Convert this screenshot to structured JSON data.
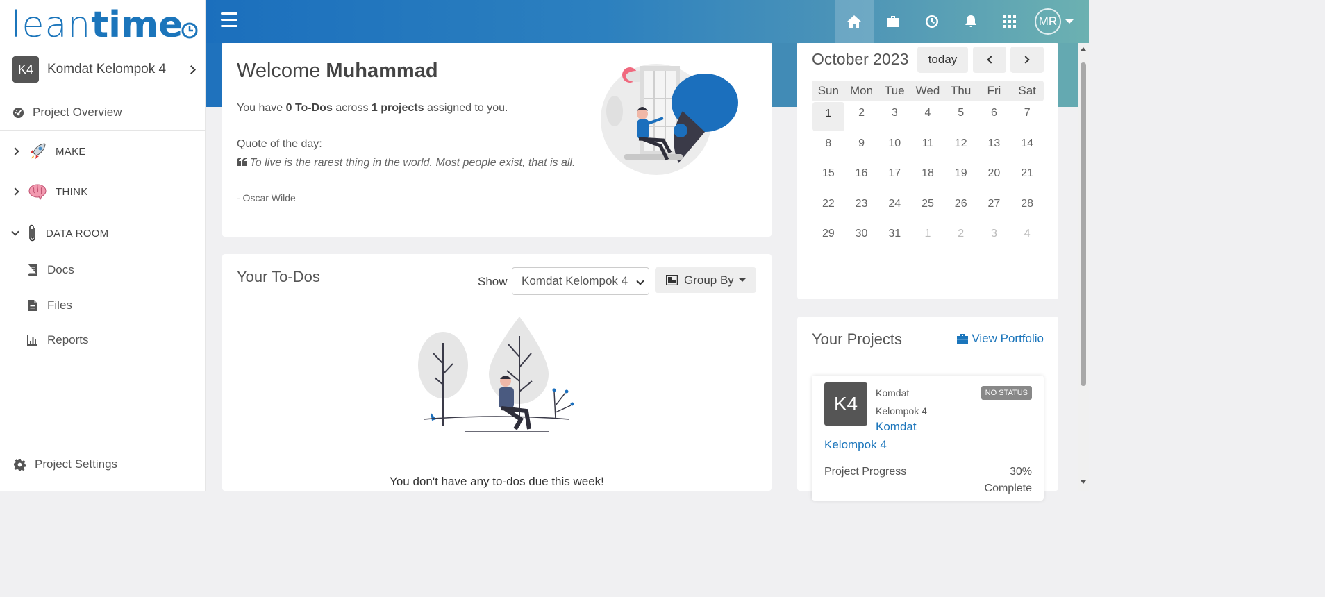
{
  "brand": {
    "logo_part1": "lean",
    "logo_part2": "time"
  },
  "sidebar": {
    "project": {
      "badge": "K4",
      "name": "Komdat Kelompok 4"
    },
    "overview_label": "Project Overview",
    "groups": [
      {
        "label": "MAKE",
        "expanded": false,
        "icon": "rocket-icon"
      },
      {
        "label": "THINK",
        "expanded": false,
        "icon": "brain-icon"
      },
      {
        "label": "DATA ROOM",
        "expanded": true,
        "icon": "paperclip-icon"
      }
    ],
    "data_room_items": [
      {
        "label": "Docs",
        "icon": "book-icon"
      },
      {
        "label": "Files",
        "icon": "file-icon"
      },
      {
        "label": "Reports",
        "icon": "chart-icon"
      }
    ],
    "settings_label": "Project Settings"
  },
  "header": {
    "nav_icons": [
      "home-icon",
      "briefcase-icon",
      "clock-icon",
      "bell-icon",
      "apps-grid-icon"
    ],
    "user_initials": "MR"
  },
  "welcome": {
    "greeting": "Welcome",
    "user_name": "Muhammad",
    "summary_prefix": "You have",
    "todo_count": "0 To-Dos",
    "summary_mid": "across",
    "project_count": "1 projects",
    "summary_suffix": "assigned to you.",
    "quote_label": "Quote of the day:",
    "quote_text": "To live is the rarest thing in the world. Most people exist, that is all.",
    "quote_author": "- Oscar Wilde"
  },
  "todos": {
    "title": "Your To-Dos",
    "show_label": "Show",
    "show_value": "Komdat Kelompok 4",
    "group_by_label": "Group By",
    "empty_message": "You don't have any to-dos due this week!"
  },
  "calendar": {
    "title": "October 2023",
    "today_label": "today",
    "weekdays": [
      "Sun",
      "Mon",
      "Tue",
      "Wed",
      "Thu",
      "Fri",
      "Sat"
    ],
    "days": [
      "1",
      "2",
      "3",
      "4",
      "5",
      "6",
      "7",
      "8",
      "9",
      "10",
      "11",
      "12",
      "13",
      "14",
      "15",
      "16",
      "17",
      "18",
      "19",
      "20",
      "21",
      "22",
      "23",
      "24",
      "25",
      "26",
      "27",
      "28",
      "29",
      "30",
      "31",
      "1",
      "2",
      "3",
      "4"
    ],
    "today_index": 0,
    "other_month_from_index": 31
  },
  "projects": {
    "title": "Your Projects",
    "view_portfolio_label": "View Portfolio",
    "card": {
      "badge": "K4",
      "client": "Komdat Kelompok 4",
      "status": "NO STATUS",
      "name_line1": "Komdat",
      "name_line2": "Kelompok 4",
      "progress_label": "Project Progress",
      "progress_value": "30%",
      "progress_sub": "Complete"
    }
  },
  "colors": {
    "accent": "#1b75bb",
    "header_start": "#1b6fbd",
    "header_end": "#6cb1b1"
  }
}
